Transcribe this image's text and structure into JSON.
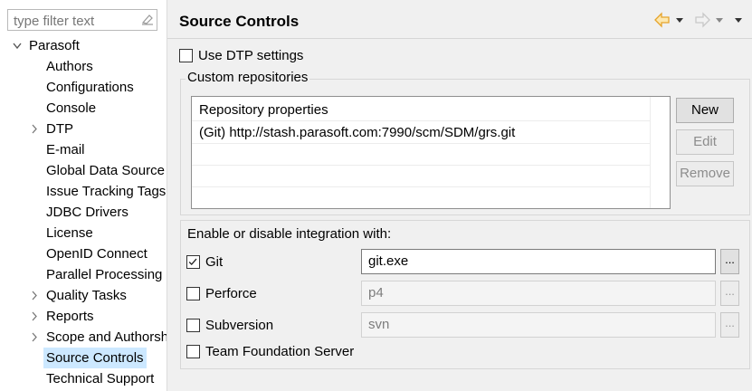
{
  "filter": {
    "placeholder": "type filter text"
  },
  "tree": {
    "root": {
      "label": "Parasoft",
      "expanded": true
    },
    "items": [
      {
        "label": "Authors",
        "expandable": false
      },
      {
        "label": "Configurations",
        "expandable": false
      },
      {
        "label": "Console",
        "expandable": false
      },
      {
        "label": "DTP",
        "expandable": true
      },
      {
        "label": "E-mail",
        "expandable": false
      },
      {
        "label": "Global Data Source",
        "expandable": false
      },
      {
        "label": "Issue Tracking Tags",
        "expandable": false
      },
      {
        "label": "JDBC Drivers",
        "expandable": false
      },
      {
        "label": "License",
        "expandable": false
      },
      {
        "label": "OpenID Connect",
        "expandable": false
      },
      {
        "label": "Parallel Processing",
        "expandable": false
      },
      {
        "label": "Quality Tasks",
        "expandable": true
      },
      {
        "label": "Reports",
        "expandable": true
      },
      {
        "label": "Scope and Authorship",
        "expandable": true
      },
      {
        "label": "Source Controls",
        "expandable": false,
        "selected": true
      },
      {
        "label": "Technical Support",
        "expandable": false
      }
    ]
  },
  "page": {
    "title": "Source Controls",
    "use_dtp": {
      "label": "Use DTP settings",
      "checked": false
    },
    "repos_group_title": "Custom repositories",
    "repos_header": "Repository properties",
    "repos_rows": [
      "(Git) http://stash.parasoft.com:7990/scm/SDM/grs.git"
    ],
    "buttons": {
      "new": "New",
      "edit": "Edit",
      "remove": "Remove"
    },
    "integration_title": "Enable or disable integration with:",
    "integrations": [
      {
        "label": "Git",
        "checked": true,
        "value": "git.exe",
        "enabled": true,
        "has_path": true
      },
      {
        "label": "Perforce",
        "checked": false,
        "value": "p4",
        "enabled": false,
        "has_path": true
      },
      {
        "label": "Subversion",
        "checked": false,
        "value": "svn",
        "enabled": false,
        "has_path": true
      },
      {
        "label": "Team Foundation Server",
        "checked": false,
        "has_path": false
      }
    ],
    "browse_label": "..."
  },
  "icons": {
    "filter_clear": "clear-filter-icon",
    "back": "back-arrow-icon",
    "forward": "forward-arrow-icon",
    "menu": "view-menu-icon"
  },
  "colors": {
    "selection": "#cce8ff",
    "back_arrow": "#e6a42b",
    "forward_arrow": "#c8c8c8"
  }
}
